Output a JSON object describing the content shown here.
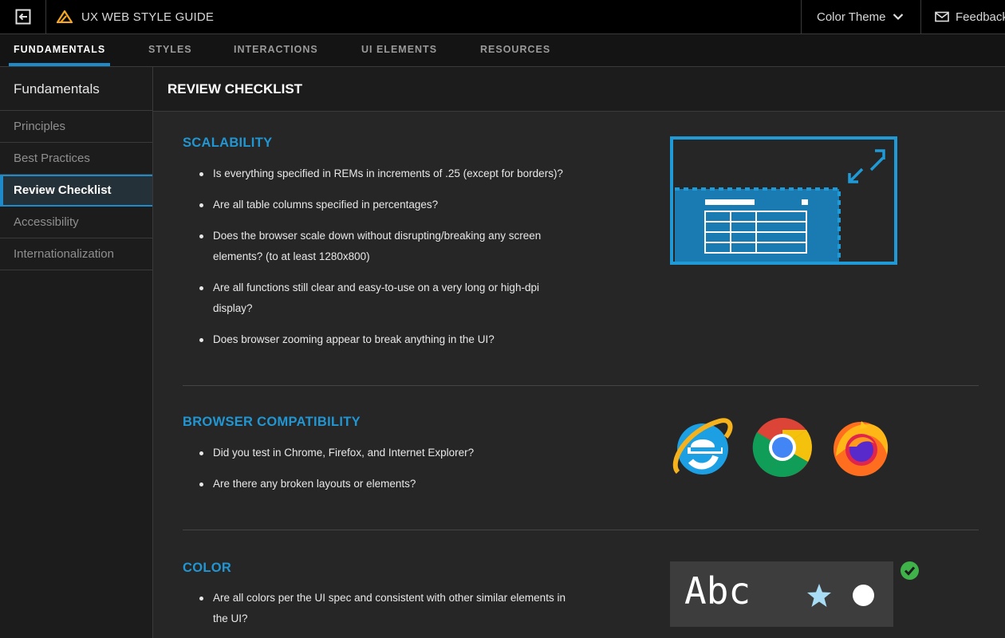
{
  "header": {
    "title": "UX WEB STYLE GUIDE",
    "color_theme_label": "Color Theme",
    "feedback_label": "Feedback"
  },
  "tabs": [
    {
      "label": "FUNDAMENTALS",
      "active": true
    },
    {
      "label": "STYLES",
      "active": false
    },
    {
      "label": "INTERACTIONS",
      "active": false
    },
    {
      "label": "UI ELEMENTS",
      "active": false
    },
    {
      "label": "RESOURCES",
      "active": false
    }
  ],
  "sidebar": {
    "heading": "Fundamentals",
    "items": [
      {
        "label": "Principles"
      },
      {
        "label": "Best Practices"
      },
      {
        "label": "Review Checklist",
        "active": true
      },
      {
        "label": "Accessibility"
      },
      {
        "label": "Internationalization"
      }
    ]
  },
  "page_title": "REVIEW CHECKLIST",
  "sections": {
    "scalability": {
      "title": "SCALABILITY",
      "items": [
        "Is everything specified in REMs in increments of .25 (except for borders)?",
        "Are all table columns specified in percentages?",
        "Does the browser scale down without disrupting/breaking any screen elements? (to at least 1280x800)",
        "Are all functions still clear and easy-to-use on a very long or high-dpi display?",
        "Does browser zooming appear to break anything in the UI?"
      ]
    },
    "browser": {
      "title": "BROWSER COMPATIBILITY",
      "items": [
        "Did you test in Chrome, Firefox, and Internet Explorer?",
        "Are there any broken layouts or elements?"
      ]
    },
    "color": {
      "title": "COLOR",
      "items": [
        "Are all colors per the UI spec and consistent with other similar elements in the UI?"
      ],
      "sample_text": "Abc"
    }
  },
  "icons": [
    "back-icon",
    "brand-logo-icon",
    "chevron-down-icon",
    "mail-icon",
    "expand-arrows-icon",
    "ie-logo-icon",
    "chrome-logo-icon",
    "firefox-logo-icon",
    "star-icon",
    "circle-icon",
    "check-icon"
  ],
  "colors": {
    "accent": "#1f8ac9",
    "section_title": "#2196d3",
    "brand_logo": "#f5a623",
    "success": "#3fb24a"
  }
}
